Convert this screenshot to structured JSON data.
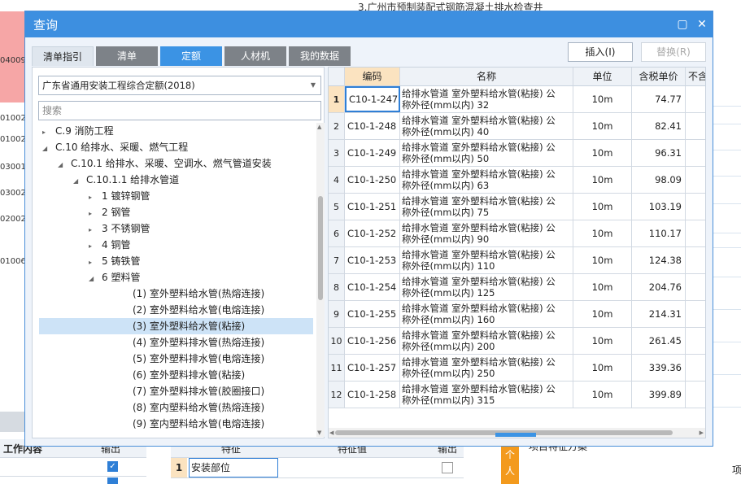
{
  "background": {
    "top_title": "3.广州市预制装配式钢筋混凝土排水检查井",
    "left_codes": [
      "04009",
      "01002",
      "01002",
      "03001",
      "03002",
      "02002",
      "01006"
    ],
    "bottom_left_label": "工作内容",
    "bottom_left_col": "输出",
    "bottom_mid_header": "特征",
    "bottom_mid_header2": "特征值",
    "bottom_mid_col": "输出",
    "bottom_row_num": "1",
    "bottom_row_value": "安装部位",
    "bottom_right_label": "项目特征方案",
    "bottom_side_tab": "个人",
    "bottom_far_right": "项"
  },
  "dialog": {
    "title": "查询",
    "tabs": [
      "清单指引",
      "清单",
      "定额",
      "人材机",
      "我的数据"
    ],
    "active_tab": "定额",
    "insert_button": "插入(I)",
    "replace_button": "替换(R)"
  },
  "left": {
    "library": "广东省通用安装工程综合定额(2018)",
    "search_placeholder": "搜索",
    "tree": [
      {
        "label": "C.9 消防工程",
        "indent": 0,
        "arrow": "▸"
      },
      {
        "label": "C.10 给排水、采暖、燃气工程",
        "indent": 0,
        "arrow": "◢"
      },
      {
        "label": "C.10.1 给排水、采暖、空调水、燃气管道安装",
        "indent": 1,
        "arrow": "◢"
      },
      {
        "label": "C.10.1.1 给排水管道",
        "indent": 2,
        "arrow": "◢"
      },
      {
        "label": "1 镀锌钢管",
        "indent": 3,
        "arrow": "▸"
      },
      {
        "label": "2 钢管",
        "indent": 3,
        "arrow": "▸"
      },
      {
        "label": "3 不锈钢管",
        "indent": 3,
        "arrow": "▸"
      },
      {
        "label": "4 铜管",
        "indent": 3,
        "arrow": "▸"
      },
      {
        "label": "5 铸铁管",
        "indent": 3,
        "arrow": "▸"
      },
      {
        "label": "6 塑料管",
        "indent": 3,
        "arrow": "◢"
      },
      {
        "label": "(1) 室外塑料给水管(热熔连接)",
        "indent": 5,
        "arrow": ""
      },
      {
        "label": "(2) 室外塑料给水管(电熔连接)",
        "indent": 5,
        "arrow": ""
      },
      {
        "label": "(3) 室外塑料给水管(粘接)",
        "indent": 5,
        "arrow": "",
        "selected": true
      },
      {
        "label": "(4) 室外塑料排水管(热熔连接)",
        "indent": 5,
        "arrow": ""
      },
      {
        "label": "(5) 室外塑料排水管(电熔连接)",
        "indent": 5,
        "arrow": ""
      },
      {
        "label": "(6) 室外塑料排水管(粘接)",
        "indent": 5,
        "arrow": ""
      },
      {
        "label": "(7) 室外塑料排水管(胶圈接口)",
        "indent": 5,
        "arrow": ""
      },
      {
        "label": "(8) 室内塑料给水管(热熔连接)",
        "indent": 5,
        "arrow": ""
      },
      {
        "label": "(9) 室内塑料给水管(电熔连接)",
        "indent": 5,
        "arrow": ""
      }
    ]
  },
  "grid": {
    "headers": [
      "编码",
      "名称",
      "单位",
      "含税单价",
      "不含"
    ],
    "rows": [
      {
        "no": "1",
        "code": "C10-1-247",
        "name1": "给排水管道 室外塑料给水管(粘接) 公",
        "name2": "称外径(mm以内) 32",
        "unit": "10m",
        "price": "74.77"
      },
      {
        "no": "2",
        "code": "C10-1-248",
        "name1": "给排水管道 室外塑料给水管(粘接) 公",
        "name2": "称外径(mm以内) 40",
        "unit": "10m",
        "price": "82.41"
      },
      {
        "no": "3",
        "code": "C10-1-249",
        "name1": "给排水管道 室外塑料给水管(粘接) 公",
        "name2": "称外径(mm以内) 50",
        "unit": "10m",
        "price": "96.31"
      },
      {
        "no": "4",
        "code": "C10-1-250",
        "name1": "给排水管道 室外塑料给水管(粘接) 公",
        "name2": "称外径(mm以内) 63",
        "unit": "10m",
        "price": "98.09"
      },
      {
        "no": "5",
        "code": "C10-1-251",
        "name1": "给排水管道 室外塑料给水管(粘接) 公",
        "name2": "称外径(mm以内) 75",
        "unit": "10m",
        "price": "103.19"
      },
      {
        "no": "6",
        "code": "C10-1-252",
        "name1": "给排水管道 室外塑料给水管(粘接) 公",
        "name2": "称外径(mm以内) 90",
        "unit": "10m",
        "price": "110.17"
      },
      {
        "no": "7",
        "code": "C10-1-253",
        "name1": "给排水管道 室外塑料给水管(粘接) 公",
        "name2": "称外径(mm以内) 110",
        "unit": "10m",
        "price": "124.38"
      },
      {
        "no": "8",
        "code": "C10-1-254",
        "name1": "给排水管道 室外塑料给水管(粘接) 公",
        "name2": "称外径(mm以内) 125",
        "unit": "10m",
        "price": "204.76"
      },
      {
        "no": "9",
        "code": "C10-1-255",
        "name1": "给排水管道 室外塑料给水管(粘接) 公",
        "name2": "称外径(mm以内) 160",
        "unit": "10m",
        "price": "214.31"
      },
      {
        "no": "10",
        "code": "C10-1-256",
        "name1": "给排水管道 室外塑料给水管(粘接) 公",
        "name2": "称外径(mm以内) 200",
        "unit": "10m",
        "price": "261.45"
      },
      {
        "no": "11",
        "code": "C10-1-257",
        "name1": "给排水管道 室外塑料给水管(粘接) 公",
        "name2": "称外径(mm以内) 250",
        "unit": "10m",
        "price": "339.36"
      },
      {
        "no": "12",
        "code": "C10-1-258",
        "name1": "给排水管道 室外塑料给水管(粘接) 公",
        "name2": "称外径(mm以内) 315",
        "unit": "10m",
        "price": "399.89"
      }
    ]
  }
}
